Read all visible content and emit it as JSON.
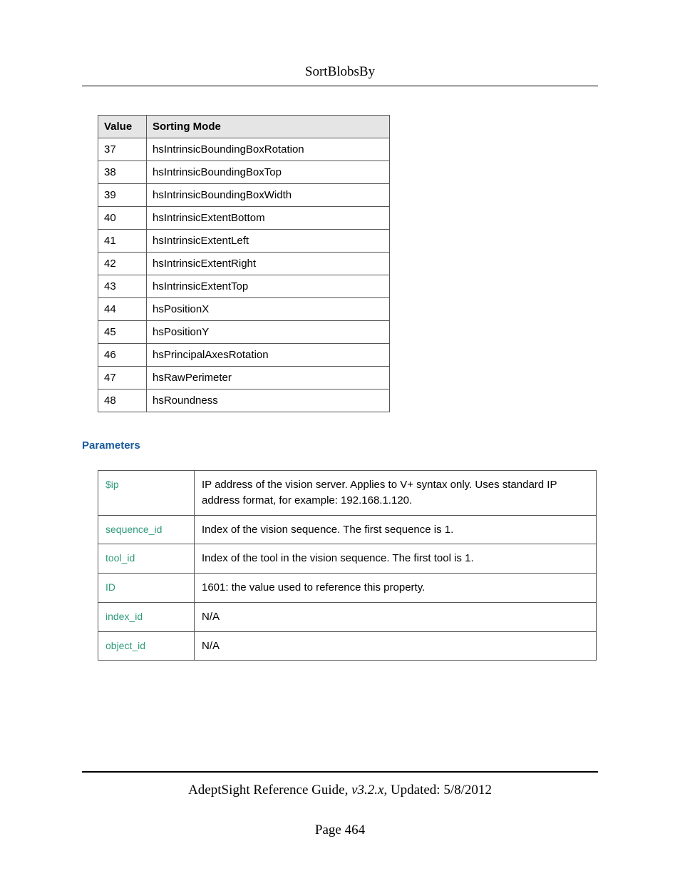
{
  "header": {
    "title": "SortBlobsBy"
  },
  "sort_table": {
    "headers": {
      "value": "Value",
      "mode": "Sorting Mode"
    },
    "rows": [
      {
        "value": "37",
        "mode": "hsIntrinsicBoundingBoxRotation"
      },
      {
        "value": "38",
        "mode": "hsIntrinsicBoundingBoxTop"
      },
      {
        "value": "39",
        "mode": "hsIntrinsicBoundingBoxWidth"
      },
      {
        "value": "40",
        "mode": "hsIntrinsicExtentBottom"
      },
      {
        "value": "41",
        "mode": "hsIntrinsicExtentLeft"
      },
      {
        "value": "42",
        "mode": "hsIntrinsicExtentRight"
      },
      {
        "value": "43",
        "mode": "hsIntrinsicExtentTop"
      },
      {
        "value": "44",
        "mode": "hsPositionX"
      },
      {
        "value": "45",
        "mode": "hsPositionY"
      },
      {
        "value": "46",
        "mode": "hsPrincipalAxesRotation"
      },
      {
        "value": "47",
        "mode": "hsRawPerimeter"
      },
      {
        "value": "48",
        "mode": "hsRoundness"
      }
    ]
  },
  "sections": {
    "parameters": "Parameters"
  },
  "params_table": {
    "rows": [
      {
        "name": "$ip",
        "desc": "IP address of the vision server. Applies to V+ syntax only. Uses standard IP address format, for example: 192.168.1.120."
      },
      {
        "name": "sequence_id",
        "desc": "Index of the vision sequence. The first sequence is 1."
      },
      {
        "name": "tool_id",
        "desc": "Index of the tool in the vision sequence. The first tool is 1."
      },
      {
        "name": "ID",
        "desc": "1601: the value used to reference this property."
      },
      {
        "name": "index_id",
        "desc": "N/A"
      },
      {
        "name": "object_id",
        "desc": "N/A"
      }
    ]
  },
  "footer": {
    "guide": "AdeptSight Reference Guide",
    "sep": ", ",
    "version": "v3.2.x",
    "updated_label": ", Updated: ",
    "updated_date": "5/8/2012",
    "page_label": "Page ",
    "page_number": "464"
  }
}
